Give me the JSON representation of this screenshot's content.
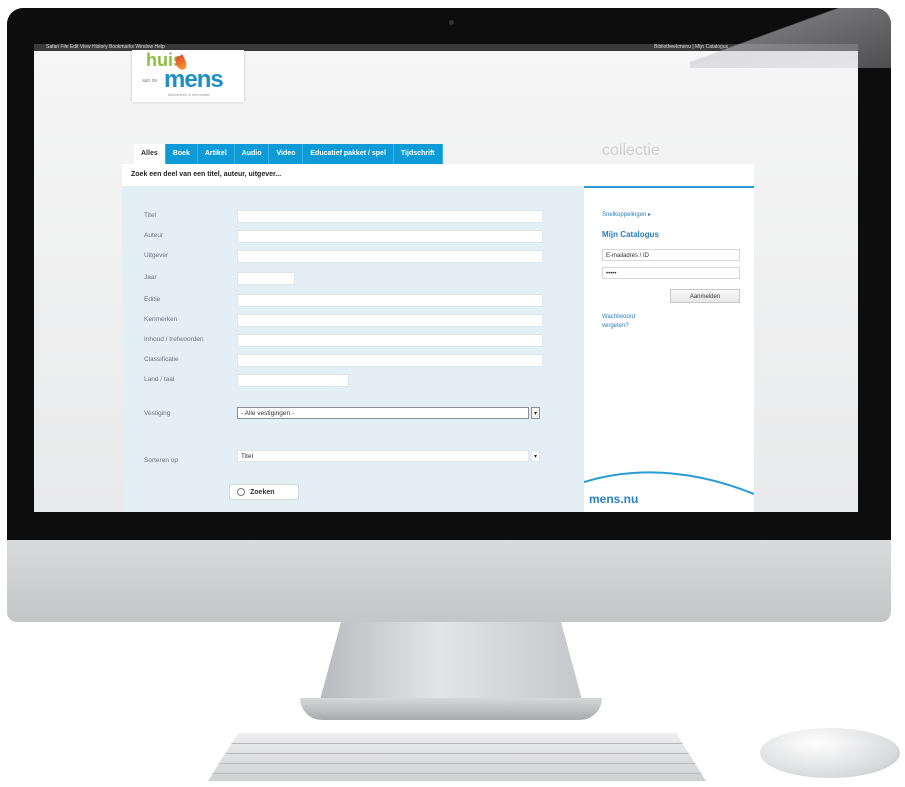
{
  "brand": {
    "huis": "huis",
    "aan_de": "aan de",
    "mens": "mens",
    "tagline": "bibliotheek & informatie",
    "right_watermark": "collectie",
    "footer_logo": "mens.nu"
  },
  "menubar": {
    "left_text": "Safari  File  Edit  View  History  Bookmarks  Window  Help",
    "right_text": "Bibliotheekmenu  |  Mijn Catalogus"
  },
  "tabs": [
    {
      "label": "Alles",
      "active": true
    },
    {
      "label": "Boek",
      "active": false
    },
    {
      "label": "Artikel",
      "active": false
    },
    {
      "label": "Audio",
      "active": false
    },
    {
      "label": "Video",
      "active": false
    },
    {
      "label": "Educatief pakket / spel",
      "active": false
    },
    {
      "label": "Tijdschrift",
      "active": false
    }
  ],
  "search_prompt": "Zoek een deel van een titel, auteur, uitgever...",
  "form": {
    "labels": {
      "titel": "Titel",
      "auteur": "Auteur",
      "uitgever": "Uitgever",
      "jaar": "Jaar",
      "editie": "Editie",
      "kenmerken": "Kenmerken",
      "inhoud": "Inhoud / trefwoorden",
      "classificatie": "Classificatie",
      "land_taal": "Land / taal",
      "vestiging": "Vestiging",
      "sorteren": "Sorteren op"
    },
    "vestiging_selected": "- Alle vestigingen -",
    "sorteren_selected": "Titel",
    "select_arrow": "▾",
    "submit_label": "Zoeken"
  },
  "sidebar": {
    "link_top": "Snelkoppelingen ▸",
    "title": "Mijn Catalogus",
    "email_value": "E-mailadres / ID",
    "password_value": "•••••",
    "login_button": "Aanmelden",
    "forgot_link_line1": "Wachtwoord",
    "forgot_link_line2": "vergeten?"
  },
  "colors": {
    "tab_blue": "#0d9bd8",
    "link_blue": "#2a7fc0",
    "form_bg": "#e4eef5",
    "logo_green": "#8cbf3f",
    "logo_flame": "#e64b2c"
  }
}
